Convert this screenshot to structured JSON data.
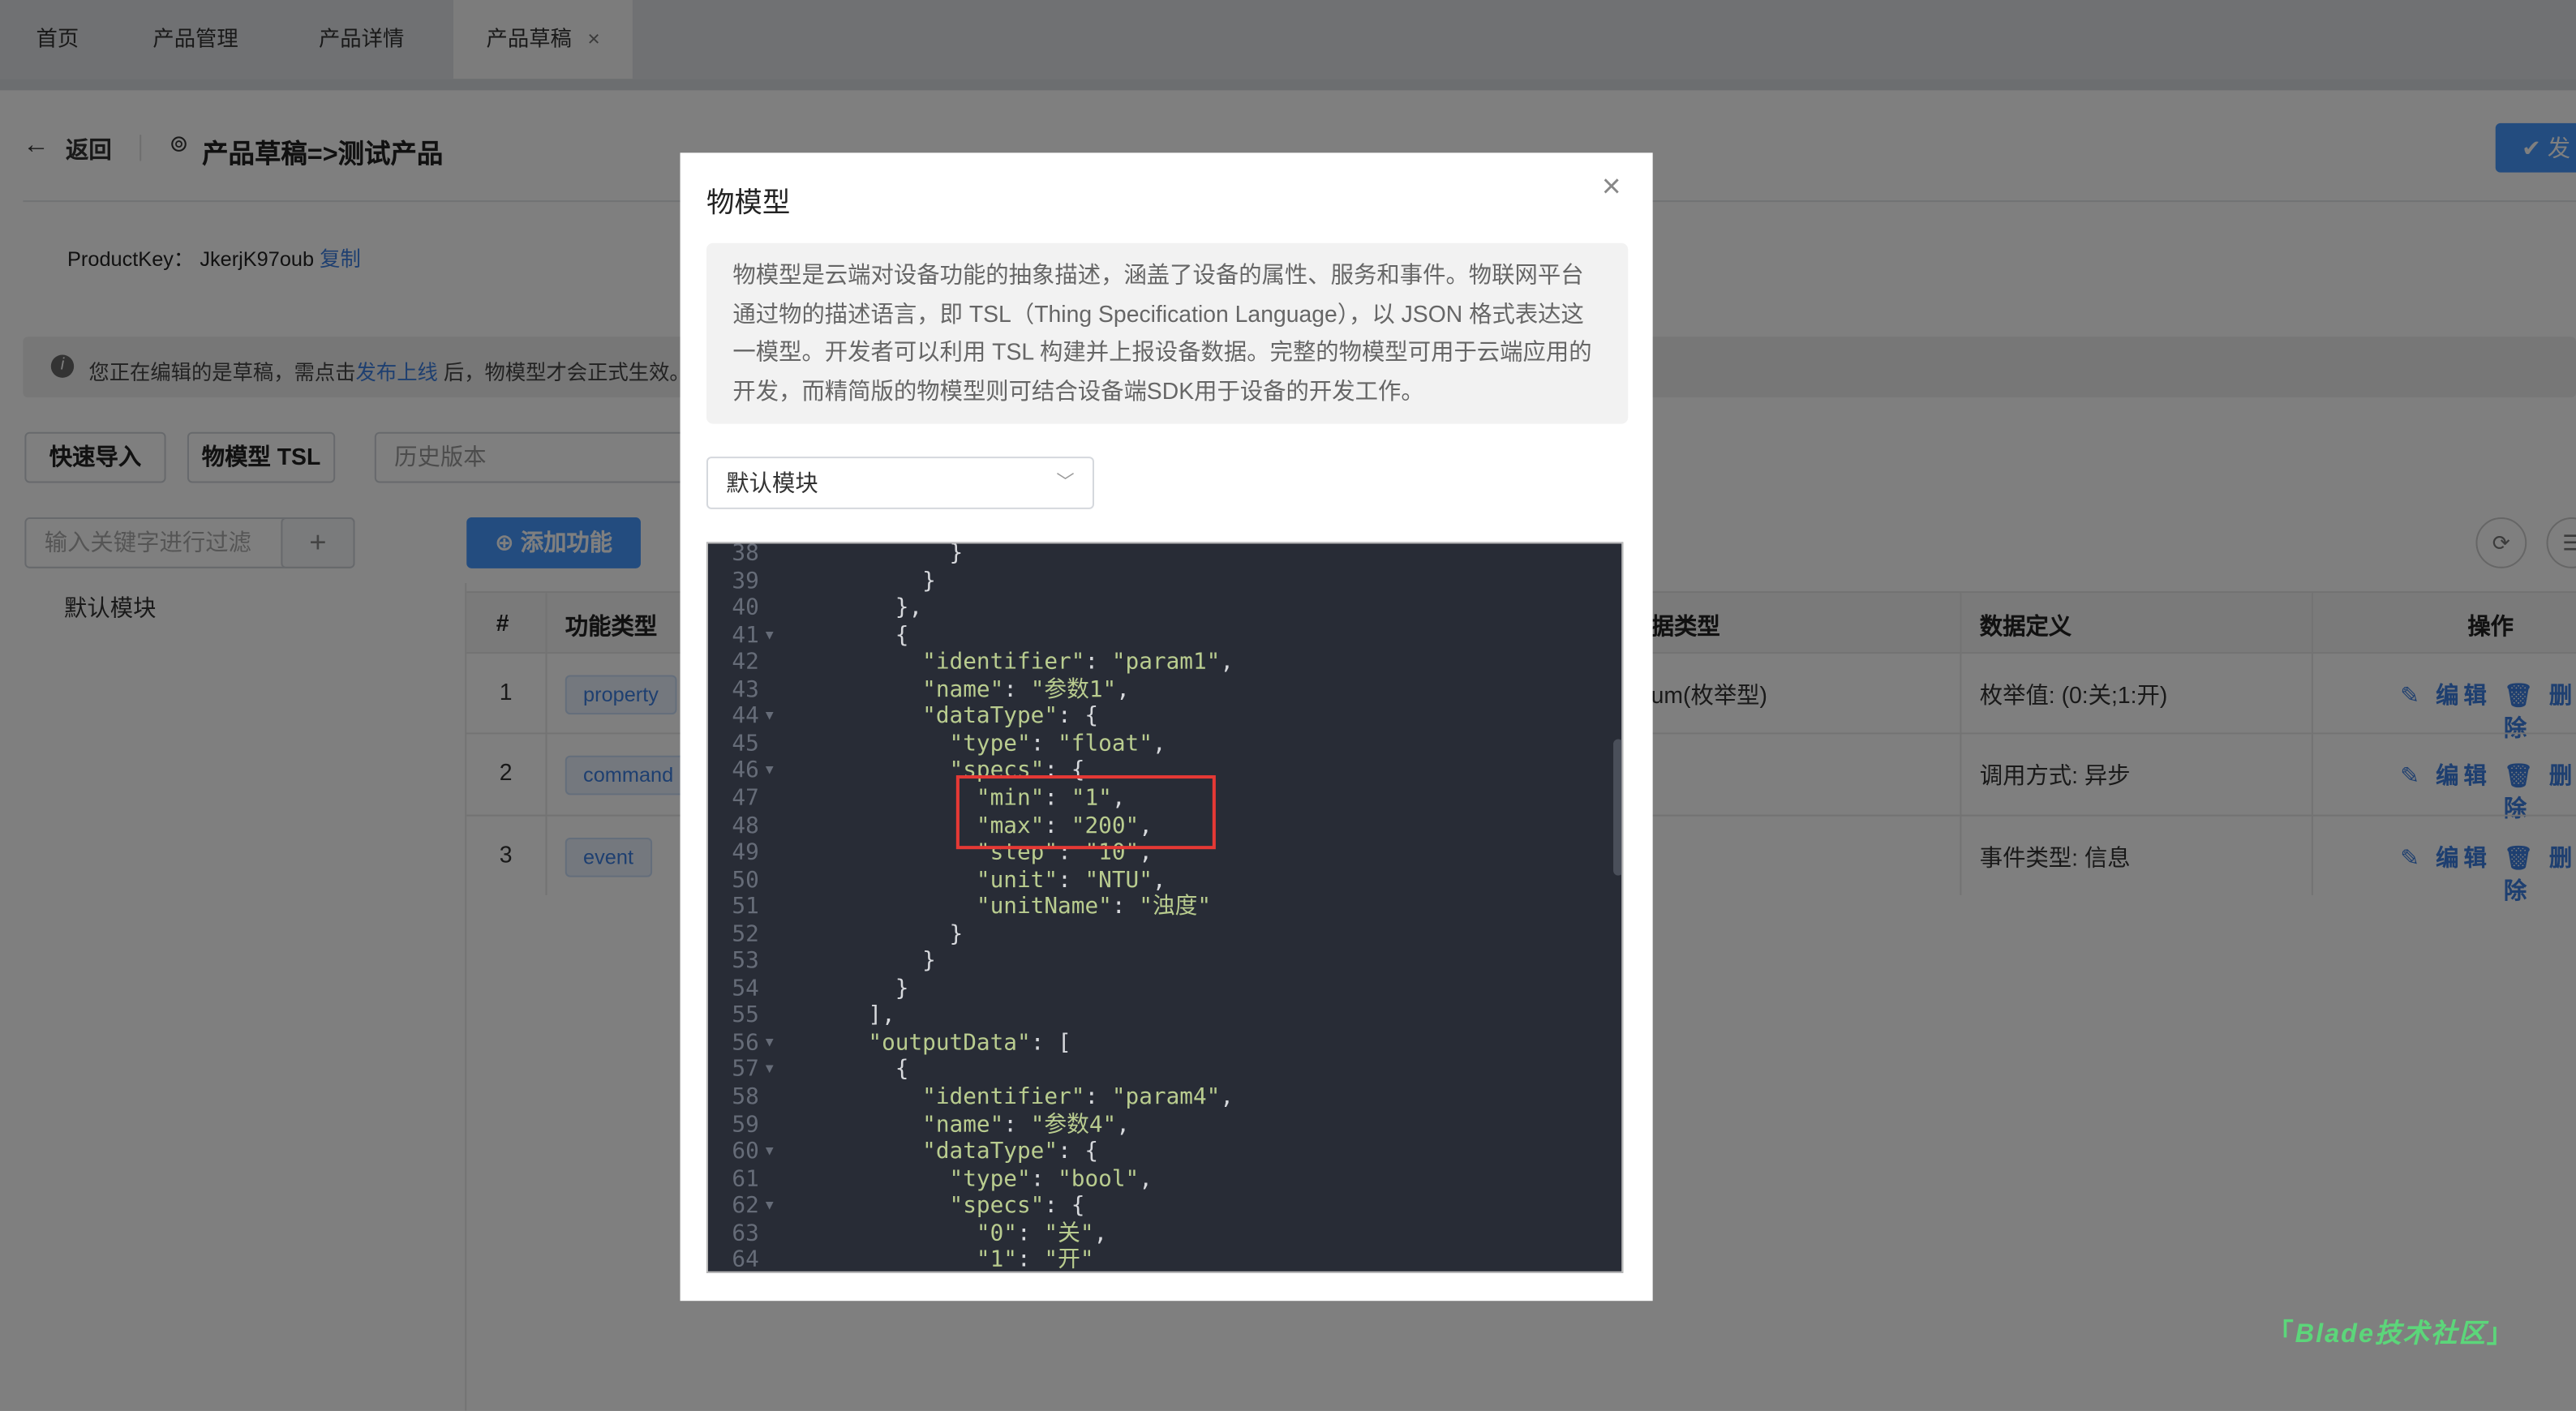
{
  "tabs": [
    {
      "label": "首页"
    },
    {
      "label": "产品管理"
    },
    {
      "label": "产品详情"
    },
    {
      "label": "产品草稿",
      "close": "×"
    }
  ],
  "header": {
    "back_label": "返回",
    "title": "产品草稿=>测试产品",
    "publish_label": "发"
  },
  "product_key": {
    "label": "ProductKey：",
    "value": "JkerjK97oub",
    "copy": "复制"
  },
  "alert": {
    "before": "您正在编辑的是草稿，需点击",
    "link": "发布上线",
    "after": " 后，物模型才会正式生效。"
  },
  "toolbar": {
    "quick_import": "快速导入",
    "tsl": "物模型 TSL",
    "history_placeholder": "历史版本"
  },
  "filter": {
    "placeholder": "输入关键字进行过滤",
    "add": "+"
  },
  "module_tree": [
    "默认模块"
  ],
  "add_function": "添加功能",
  "table": {
    "headers": [
      "#",
      "功能类型",
      "据类型",
      "数据定义",
      "操作"
    ],
    "rows": [
      {
        "no": "1",
        "type": "property",
        "datatype": "um(枚举型)",
        "def": "枚举值: (0:关;1:开)"
      },
      {
        "no": "2",
        "type": "command",
        "datatype": "",
        "def": "调用方式: 异步"
      },
      {
        "no": "3",
        "type": "event",
        "datatype": "",
        "def": "事件类型: 信息"
      }
    ],
    "edit": "编辑",
    "delete": "删除"
  },
  "modal": {
    "title": "物模型",
    "close": "×",
    "description": "物模型是云端对设备功能的抽象描述，涵盖了设备的属性、服务和事件。物联网平台通过物的描述语言，即 TSL（Thing Specification Language），以 JSON 格式表达这一模型。开发者可以利用 TSL 构建并上报设备数据。完整的物模型可用于云端应用的开发，而精简版的物模型则可结合设备端SDK用于设备的开发工作。",
    "module_select": "默认模块",
    "code_lines": [
      {
        "n": "38",
        "text": "            }"
      },
      {
        "n": "39",
        "text": "          }"
      },
      {
        "n": "40",
        "text": "        },"
      },
      {
        "n": "41",
        "text": "        {",
        "fold": true
      },
      {
        "n": "42",
        "text": "          \"identifier\": \"param1\","
      },
      {
        "n": "43",
        "text": "          \"name\": \"参数1\","
      },
      {
        "n": "44",
        "text": "          \"dataType\": {",
        "fold": true
      },
      {
        "n": "45",
        "text": "            \"type\": \"float\","
      },
      {
        "n": "46",
        "text": "            \"specs\": {",
        "fold": true
      },
      {
        "n": "47",
        "text": "              \"min\": \"1\","
      },
      {
        "n": "48",
        "text": "              \"max\": \"200\","
      },
      {
        "n": "49",
        "text": "              \"step\": \"10\","
      },
      {
        "n": "50",
        "text": "              \"unit\": \"NTU\","
      },
      {
        "n": "51",
        "text": "              \"unitName\": \"浊度\""
      },
      {
        "n": "52",
        "text": "            }"
      },
      {
        "n": "53",
        "text": "          }"
      },
      {
        "n": "54",
        "text": "        }"
      },
      {
        "n": "55",
        "text": "      ],"
      },
      {
        "n": "56",
        "text": "      \"outputData\": [",
        "fold": true
      },
      {
        "n": "57",
        "text": "        {",
        "fold": true
      },
      {
        "n": "58",
        "text": "          \"identifier\": \"param4\","
      },
      {
        "n": "59",
        "text": "          \"name\": \"参数4\","
      },
      {
        "n": "60",
        "text": "          \"dataType\": {",
        "fold": true
      },
      {
        "n": "61",
        "text": "            \"type\": \"bool\","
      },
      {
        "n": "62",
        "text": "            \"specs\": {",
        "fold": true
      },
      {
        "n": "63",
        "text": "              \"0\": \"关\","
      },
      {
        "n": "64",
        "text": "              \"1\": \"开\""
      }
    ]
  },
  "watermark": "Blade技术社区",
  "colors": {
    "primary": "#4698fe",
    "highlight_box": "#e53935",
    "editor_bg": "#282c36",
    "watermark": "#5cd67a"
  }
}
